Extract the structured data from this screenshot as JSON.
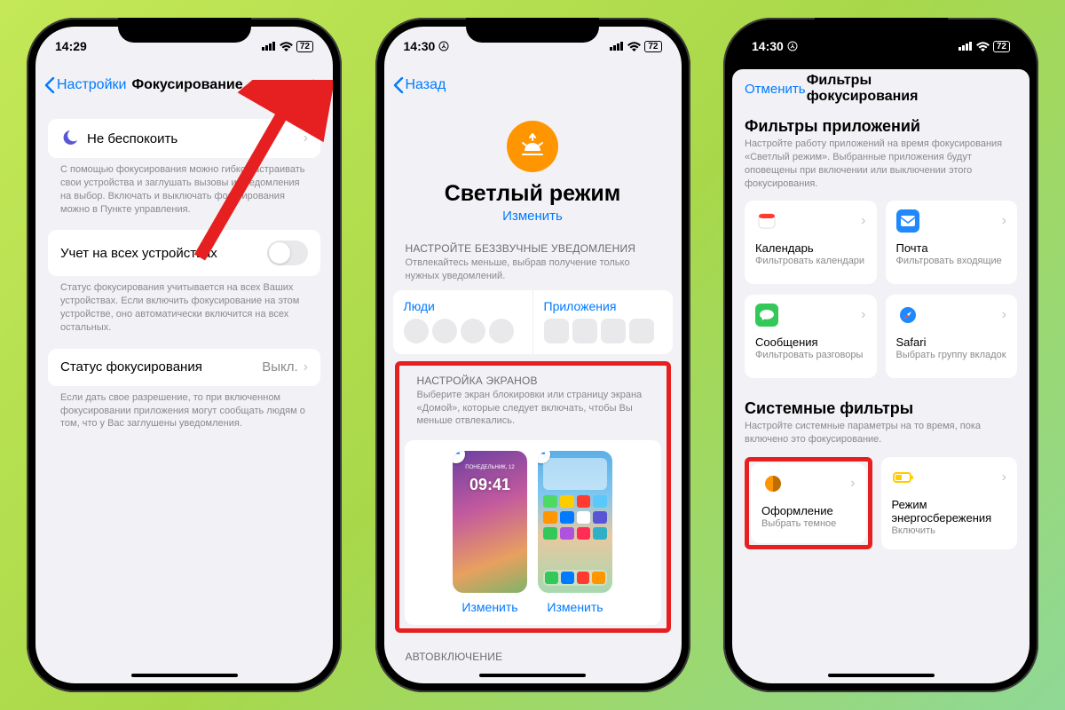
{
  "statusbar": {
    "time1": "14:29",
    "time2": "14:30",
    "time3": "14:30",
    "battery": "72"
  },
  "phone1": {
    "back": "Настройки",
    "title": "Фокусирование",
    "dnd": "Не беспокоить",
    "dnd_footer": "С помощью фокусирования можно гибко настраивать свои устройства и заглушать вызовы и уведомления на выбор. Включать и выключать фокусирования можно в Пункте управления.",
    "share": "Учет на всех устройствах",
    "share_footer": "Статус фокусирования учитывается на всех Ваших устройствах. Если включить фокусирование на этом устройстве, оно автоматически включится на всех остальных.",
    "status": "Статус фокусирования",
    "status_value": "Выкл.",
    "status_footer": "Если дать свое разрешение, то при включенном фокусировании приложения могут сообщать людям о том, что у Вас заглушены уведомления."
  },
  "phone2": {
    "back": "Назад",
    "hero_title": "Светлый режим",
    "hero_link": "Изменить",
    "notif_hdr": "НАСТРОЙТЕ БЕЗЗВУЧНЫЕ УВЕДОМЛЕНИЯ",
    "notif_sub": "Отвлекайтесь меньше, выбрав получение только нужных уведомлений.",
    "people": "Люди",
    "apps": "Приложения",
    "screens_hdr": "НАСТРОЙКА ЭКРАНОВ",
    "screens_sub": "Выберите экран блокировки или страницу экрана «Домой», которые следует включать, чтобы Вы меньше отвлекались.",
    "lock_time": "09:41",
    "edit1": "Изменить",
    "edit2": "Изменить",
    "auto_hdr": "АВТОВКЛЮЧЕНИЕ"
  },
  "phone3": {
    "cancel": "Отменить",
    "title": "Фильтры фокусирования",
    "apps_title": "Фильтры приложений",
    "apps_sub": "Настройте работу приложений на время фокусирования «Светлый режим». Выбранные приложения будут оповещены при включении или выключении этого фокусирования.",
    "tiles": {
      "calendar": {
        "name": "Календарь",
        "sub": "Фильтровать календари"
      },
      "mail": {
        "name": "Почта",
        "sub": "Фильтровать входящие"
      },
      "messages": {
        "name": "Сообщения",
        "sub": "Фильтровать разговоры"
      },
      "safari": {
        "name": "Safari",
        "sub": "Выбрать группу вкладок"
      }
    },
    "sys_title": "Системные фильтры",
    "sys_sub": "Настройте системные параметры на то время, пока включено это фокусирование.",
    "appearance": {
      "name": "Оформление",
      "sub": "Выбрать темное"
    },
    "lowpower": {
      "name": "Режим энергосбережения",
      "sub": "Включить"
    }
  }
}
